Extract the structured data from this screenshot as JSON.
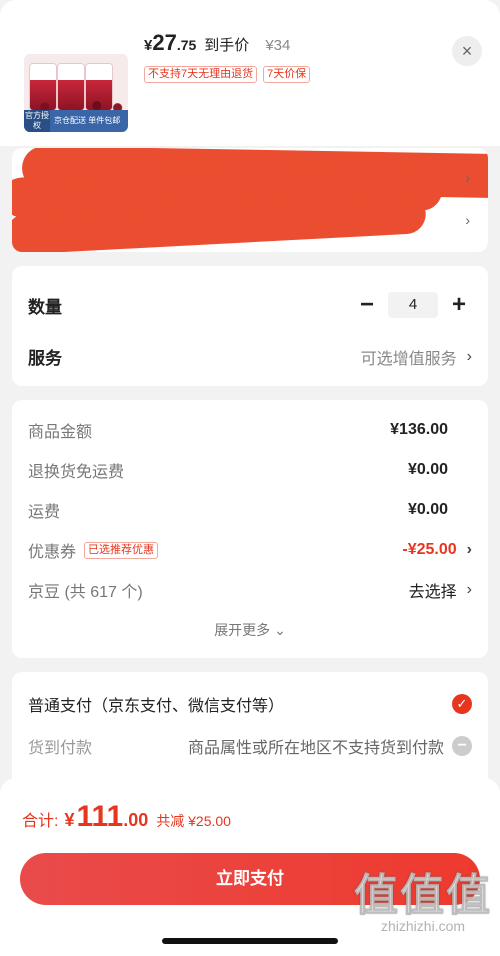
{
  "header": {
    "product_image": {
      "official_label": "官方授权",
      "strip_text": "京仓配送 单件包邮"
    },
    "price_yen": "¥",
    "price_int": "27",
    "price_dec": ".75",
    "price_label": "到手价",
    "original_price": "¥34",
    "tags": [
      "不支持7天无理由退货",
      "7天价保"
    ],
    "close_icon": "×"
  },
  "address": {
    "redacted": true
  },
  "quantity": {
    "label": "数量",
    "minus": "−",
    "value": "4",
    "plus": "+"
  },
  "service": {
    "label": "服务",
    "value": "可选增值服务"
  },
  "summary": {
    "rows": [
      {
        "label": "商品金额",
        "value": "¥136.00"
      },
      {
        "label": "退换货免运费",
        "value": "¥0.00"
      },
      {
        "label": "运费",
        "value": "¥0.00"
      }
    ],
    "coupon": {
      "label": "优惠券",
      "tag": "已选推荐优惠",
      "value": "-¥25.00"
    },
    "jd_beans": {
      "label": "京豆 (共 617 个)",
      "value": "去选择"
    },
    "expand": "展开更多 ⌄"
  },
  "payment": {
    "normal": "普通支付（京东支付、微信支付等）",
    "cod_label": "货到付款",
    "cod_note": "商品属性或所在地区不支持货到付款"
  },
  "bottom": {
    "total_label": "合计:",
    "total_yen": "¥",
    "total_int": "111",
    "total_dec": ".00",
    "saved": "共减 ¥25.00",
    "pay_button": "立即支付"
  },
  "watermark": {
    "big": "值值值",
    "small": "zhizhizhi.com"
  },
  "colors": {
    "accent": "#e6361f",
    "button": "#ee3a2e"
  }
}
